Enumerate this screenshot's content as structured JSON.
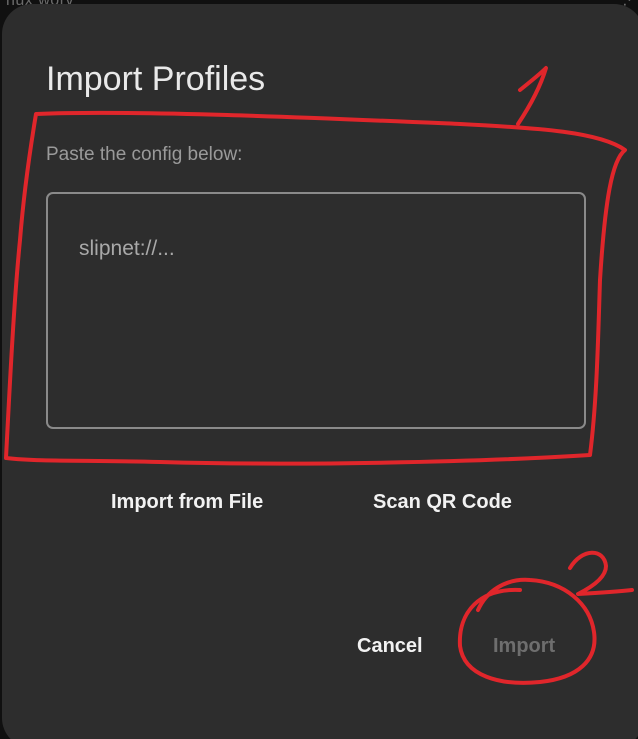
{
  "background": {
    "peek_text": "nux worv",
    "peek_icon": "share-icon"
  },
  "dialog": {
    "title": "Import Profiles",
    "hint": "Paste the config below:",
    "config_input": {
      "value": "",
      "placeholder": "slipnet://..."
    },
    "import_from_file_label": "Import from File",
    "scan_qr_label": "Scan QR Code",
    "cancel_label": "Cancel",
    "import_label": "Import",
    "import_enabled": false
  },
  "annotations": {
    "marker_1": "1",
    "marker_2": "2",
    "ink_color": "#e0262b"
  },
  "colors": {
    "dialog_bg": "#2d2d2d",
    "text_primary": "#e9e9e9",
    "text_secondary": "#9a9a9a",
    "disabled": "#6e6e6e"
  }
}
